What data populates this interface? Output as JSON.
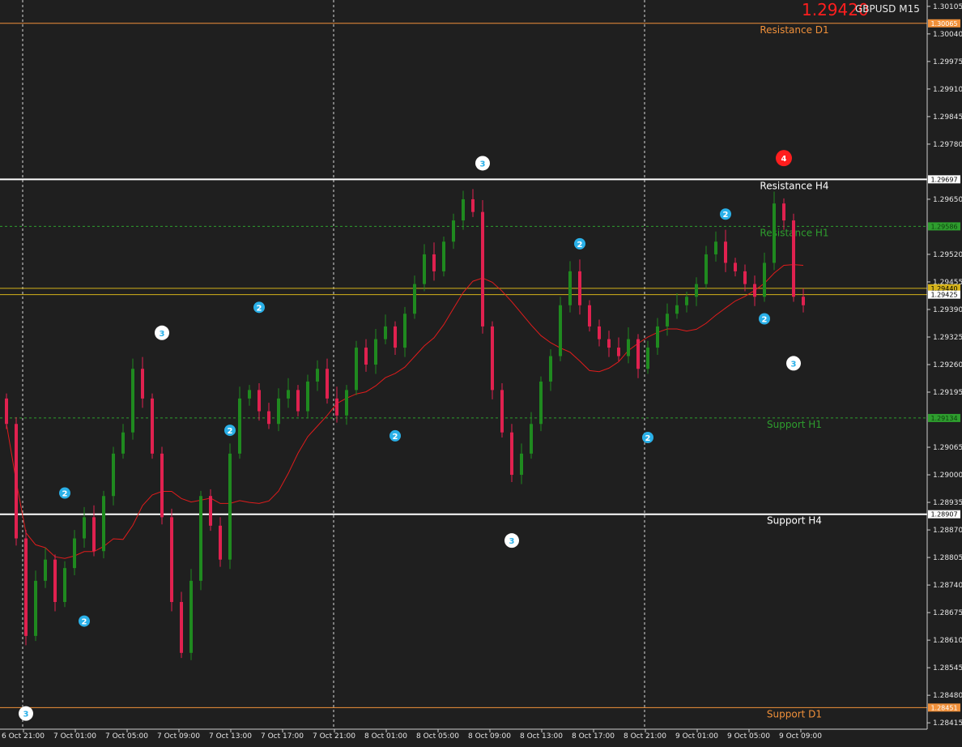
{
  "header": {
    "bid_price": "1.29420",
    "symbol_timeframe": "GBPUSD M15"
  },
  "colors": {
    "background": "#1f1f1f",
    "bull_candle": "#1f8a1f",
    "bear_candle": "#e0214f",
    "ma_line": "#e01c1c",
    "resistance_d1": "#f0903a",
    "support_d1": "#f0903a",
    "h4_level": "#ffffff",
    "h1_level": "#2e9e2e",
    "current_price_lines": "#d4b21a",
    "wave_label_2": "#2ab0e8",
    "wave_label_3": "#ffffff",
    "wave_label_4": "#ff1e1e"
  },
  "price_axis": {
    "ticks": [
      "1.30105",
      "1.30040",
      "1.29975",
      "1.29910",
      "1.29845",
      "1.29780",
      "1.29650",
      "1.29520",
      "1.29455",
      "1.29390",
      "1.29325",
      "1.29260",
      "1.29195",
      "1.29065",
      "1.29000",
      "1.28935",
      "1.28870",
      "1.28805",
      "1.28740",
      "1.28675",
      "1.28610",
      "1.28545",
      "1.28480",
      "1.28415"
    ],
    "tags": [
      {
        "text": "1.30065",
        "price": 1.30065,
        "kind": "d1"
      },
      {
        "text": "1.29697",
        "price": 1.29697,
        "kind": "h4"
      },
      {
        "text": "1.29586",
        "price": 1.29586,
        "kind": "h1"
      },
      {
        "text": "1.29440",
        "price": 1.2944,
        "kind": "current"
      },
      {
        "text": "1.29425",
        "price": 1.29425,
        "kind": "bid"
      },
      {
        "text": "1.29134",
        "price": 1.29134,
        "kind": "h1"
      },
      {
        "text": "1.28907",
        "price": 1.28907,
        "kind": "h4"
      },
      {
        "text": "1.28451",
        "price": 1.28451,
        "kind": "d1"
      }
    ]
  },
  "time_axis": {
    "labels": [
      "6 Oct 21:00",
      "7 Oct 01:00",
      "7 Oct 05:00",
      "7 Oct 09:00",
      "7 Oct 13:00",
      "7 Oct 17:00",
      "7 Oct 21:00",
      "8 Oct 01:00",
      "8 Oct 05:00",
      "8 Oct 09:00",
      "8 Oct 13:00",
      "8 Oct 17:00",
      "8 Oct 21:00",
      "9 Oct 01:00",
      "9 Oct 05:00",
      "9 Oct 09:00"
    ]
  },
  "levels": [
    {
      "label": "Resistance D1",
      "price": 1.30065,
      "kind": "d1"
    },
    {
      "label": "Resistance H4",
      "price": 1.29697,
      "kind": "h4"
    },
    {
      "label": "Resistance H1",
      "price": 1.29586,
      "kind": "h1"
    },
    {
      "label": "Support H1",
      "price": 1.29134,
      "kind": "h1"
    },
    {
      "label": "Support H4",
      "price": 1.28907,
      "kind": "h4"
    },
    {
      "label": "Support D1",
      "price": 1.28451,
      "kind": "d1"
    }
  ],
  "wave_labels": [
    {
      "text": "3",
      "price": 1.28437,
      "candle": 2
    },
    {
      "text": "2",
      "price": 1.28957,
      "candle": 6
    },
    {
      "text": "2",
      "price": 1.28655,
      "candle": 8
    },
    {
      "text": "3",
      "price": 1.29335,
      "candle": 16
    },
    {
      "text": "2",
      "price": 1.29105,
      "candle": 23
    },
    {
      "text": "2",
      "price": 1.29395,
      "candle": 26
    },
    {
      "text": "3",
      "price": 1.29735,
      "candle": 49
    },
    {
      "text": "2",
      "price": 1.29092,
      "candle": 40
    },
    {
      "text": "3",
      "price": 1.28845,
      "candle": 52
    },
    {
      "text": "2",
      "price": 1.29545,
      "candle": 59
    },
    {
      "text": "2",
      "price": 1.29088,
      "candle": 66
    },
    {
      "text": "2",
      "price": 1.29615,
      "candle": 74
    },
    {
      "text": "2",
      "price": 1.29368,
      "candle": 78
    },
    {
      "text": "4",
      "price": 1.29747,
      "candle": 80
    },
    {
      "text": "3",
      "price": 1.29263,
      "candle": 81
    }
  ],
  "chart_data": {
    "type": "candlestick",
    "symbol": "GBPUSD",
    "timeframe": "M15",
    "ylim": [
      1.284,
      1.3012
    ],
    "candle_close_path": [
      1.2912,
      1.2885,
      1.2862,
      1.2875,
      1.288,
      1.287,
      1.2878,
      1.2885,
      1.289,
      1.2882,
      1.2895,
      1.2905,
      1.291,
      1.2925,
      1.2918,
      1.2905,
      1.289,
      1.287,
      1.2858,
      1.2875,
      1.2895,
      1.2888,
      1.288,
      1.2905,
      1.2918,
      1.292,
      1.2915,
      1.2912,
      1.2918,
      1.292,
      1.2915,
      1.2922,
      1.2925,
      1.2918,
      1.2914,
      1.292,
      1.293,
      1.2926,
      1.2932,
      1.2935,
      1.293,
      1.2938,
      1.2945,
      1.2952,
      1.2948,
      1.2955,
      1.296,
      1.2965,
      1.2962,
      1.2935,
      1.292,
      1.291,
      1.29,
      1.2905,
      1.2912,
      1.2922,
      1.2928,
      1.294,
      1.2948,
      1.294,
      1.2935,
      1.2932,
      1.293,
      1.2928,
      1.2932,
      1.2925,
      1.293,
      1.2935,
      1.2938,
      1.294,
      1.2942,
      1.2945,
      1.2952,
      1.2955,
      1.295,
      1.2948,
      1.2945,
      1.2942,
      1.295,
      1.2964,
      1.296,
      1.2942,
      1.294
    ]
  }
}
